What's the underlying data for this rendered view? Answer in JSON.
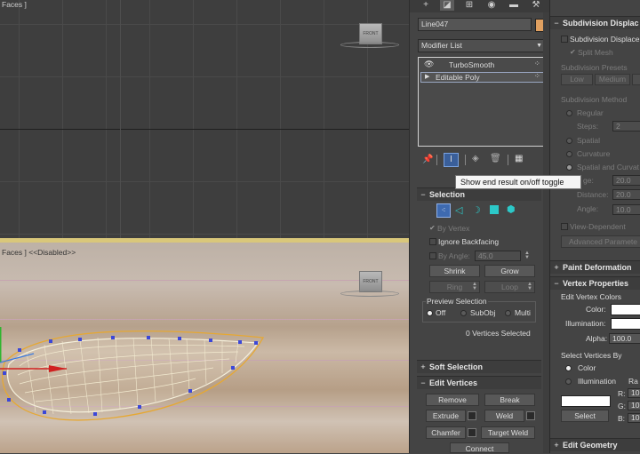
{
  "viewport_top": {
    "label": "Faces ]",
    "cube_label": "FRONT"
  },
  "viewport_bottom": {
    "label": "Faces ]  <<Disabled>>",
    "cube_label": "FRONT"
  },
  "command_panel": {
    "tabs": [
      "create-icon",
      "modify-icon",
      "hierarchy-icon",
      "motion-icon",
      "display-icon",
      "utilities-icon"
    ],
    "object_name": "Line047",
    "object_color": "#e0a060",
    "modifier_list_label": "Modifier List",
    "modifier_stack": [
      {
        "name": "TurboSmooth"
      },
      {
        "name": "Editable Poly"
      }
    ],
    "tooltip": "Show end result on/off toggle"
  },
  "selection": {
    "title": "Selection",
    "by_vertex": "By Vertex",
    "ignore_backfacing": "Ignore Backfacing",
    "by_angle": "By Angle:",
    "angle_value": "45.0",
    "shrink": "Shrink",
    "grow": "Grow",
    "ring": "Ring",
    "loop": "Loop",
    "preview_title": "Preview Selection",
    "preview_options": [
      "Off",
      "SubObj",
      "Multi"
    ],
    "status": "0 Vertices Selected"
  },
  "soft_selection": {
    "title": "Soft Selection"
  },
  "edit_vertices": {
    "title": "Edit Vertices",
    "remove": "Remove",
    "break": "Break",
    "extrude": "Extrude",
    "weld": "Weld",
    "chamfer": "Chamfer",
    "target_weld": "Target Weld",
    "connect": "Connect"
  },
  "right_panel": {
    "subdiv_title": "Subdivision Displac",
    "subdiv_check": "Subdivision Displace",
    "split_mesh": "Split Mesh",
    "presets_title": "Subdivision Presets",
    "preset_low": "Low",
    "preset_medium": "Medium",
    "method_title": "Subdivision Method",
    "regular": "Regular",
    "steps": "Steps:",
    "steps_value": "2",
    "spatial": "Spatial",
    "curvature": "Curvature",
    "spatial_and_curv": "Spatial and Curvat",
    "edge": "ge:",
    "edge_value": "20.0",
    "distance": "Distance:",
    "distance_value": "20.0",
    "angle": "Angle:",
    "angle_value": "10.0",
    "view_dependent": "View-Dependent",
    "advanced": "Advanced Paramete",
    "paint_deformation": "Paint Deformation",
    "vertex_properties": "Vertex Properties",
    "edit_vertex_colors": "Edit Vertex Colors",
    "color": "Color:",
    "illumination": "Illumination:",
    "alpha": "Alpha:",
    "alpha_value": "100.0",
    "select_vertices_by": "Select Vertices By",
    "sv_color": "Color",
    "sv_illumination": "Illumination",
    "range_label": "Ra",
    "r": "R:",
    "g": "G:",
    "b": "B:",
    "rgb_value": "10",
    "select": "Select",
    "edit_geometry": "Edit Geometry"
  }
}
